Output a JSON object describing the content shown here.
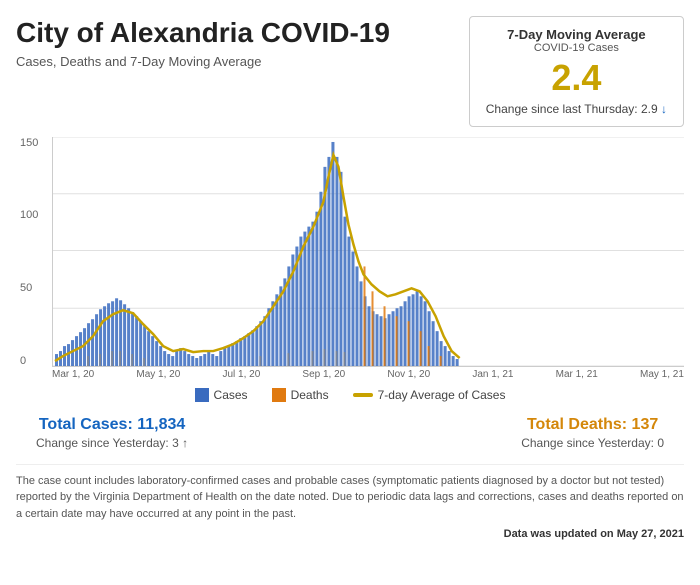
{
  "header": {
    "title": "City of Alexandria COVID-19",
    "subtitle": "Cases, Deaths and 7-Day Moving Average"
  },
  "stat_box": {
    "title": "7-Day Moving Average",
    "subtitle": "COVID-19 Cases",
    "value": "2.4",
    "change_label": "Change since last Thursday: 2.9",
    "change_arrow": "↓"
  },
  "chart": {
    "y_labels": [
      "150",
      "100",
      "50",
      "0"
    ],
    "x_labels": [
      "Mar 1, 20",
      "May 1, 20",
      "Jul 1, 20",
      "Sep 1, 20",
      "Nov 1, 20",
      "Jan 1, 21",
      "Mar 1, 21",
      "May 1, 21"
    ]
  },
  "legend": {
    "cases_label": "Cases",
    "deaths_label": "Deaths",
    "avg_label": "7-day Average of Cases",
    "cases_color": "#3a6bbf",
    "deaths_color": "#e07a10",
    "avg_color": "#c8a200"
  },
  "totals": {
    "cases_label": "Total Cases: 11,834",
    "cases_change": "Change since Yesterday: 3 ↑",
    "deaths_label": "Total Deaths: 137",
    "deaths_change": "Change since Yesterday: 0"
  },
  "footnote": "The case count includes laboratory-confirmed cases and probable cases (symptomatic patients diagnosed by a doctor but not tested) reported by the Virginia Department of Health on the date noted. Due to periodic data lags and corrections, cases and deaths reported on a certain date may have occurred at any point in the past.",
  "update": {
    "prefix": "Data was updated on",
    "date": "May 27, 2021"
  }
}
